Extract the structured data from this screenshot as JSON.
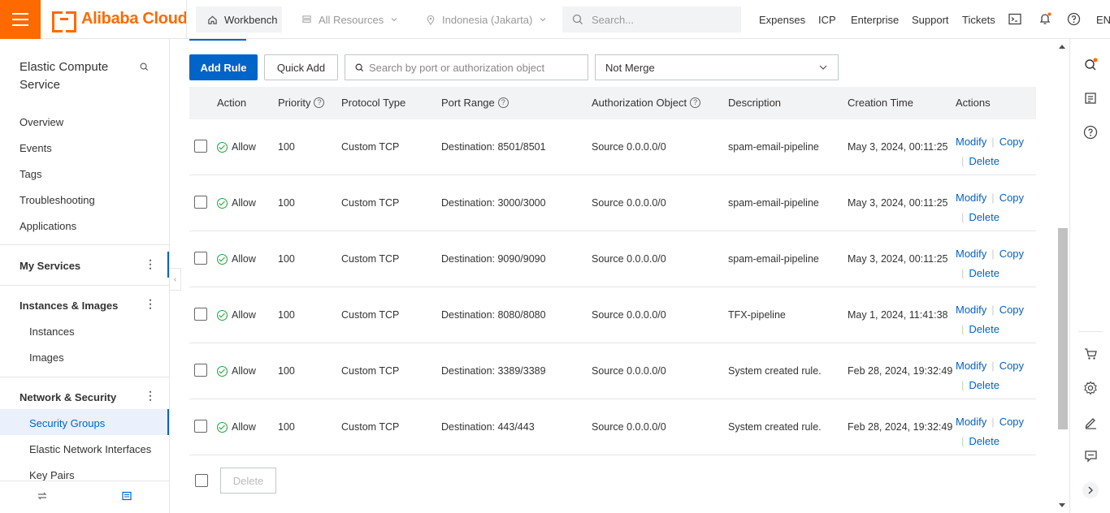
{
  "topbar": {
    "brand": "Alibaba Cloud",
    "workbench": "Workbench",
    "all_resources": "All Resources",
    "region": "Indonesia (Jakarta)",
    "search_placeholder": "Search...",
    "links": [
      "Expenses",
      "ICP",
      "Enterprise",
      "Support",
      "Tickets"
    ],
    "lang": "EN",
    "brand_color": "#ff6a00"
  },
  "sidebar": {
    "title": "Elastic Compute Service",
    "items": [
      "Overview",
      "Events",
      "Tags",
      "Troubleshooting",
      "Applications"
    ],
    "my_services": "My Services",
    "group1": {
      "label": "Instances & Images",
      "items": [
        "Instances",
        "Images"
      ]
    },
    "group2": {
      "label": "Network & Security",
      "items": [
        "Security Groups",
        "Elastic Network Interfaces",
        "Key Pairs"
      ]
    }
  },
  "toolbar": {
    "add_rule": "Add Rule",
    "quick_add": "Quick Add",
    "search_placeholder": "Search by port or authorization object",
    "merge_select": "Not Merge"
  },
  "table": {
    "headers": {
      "action": "Action",
      "priority": "Priority",
      "protocol": "Protocol Type",
      "port": "Port Range",
      "auth": "Authorization Object",
      "description": "Description",
      "created": "Creation Time",
      "actions": "Actions"
    },
    "rows": [
      {
        "action": "Allow",
        "priority": "100",
        "protocol": "Custom TCP",
        "port": "Destination: 8501/8501",
        "auth": "Source 0.0.0.0/0",
        "description": "spam-email-pipeline",
        "created": "May 3, 2024, 00:11:25"
      },
      {
        "action": "Allow",
        "priority": "100",
        "protocol": "Custom TCP",
        "port": "Destination: 3000/3000",
        "auth": "Source 0.0.0.0/0",
        "description": "spam-email-pipeline",
        "created": "May 3, 2024, 00:11:25"
      },
      {
        "action": "Allow",
        "priority": "100",
        "protocol": "Custom TCP",
        "port": "Destination: 9090/9090",
        "auth": "Source 0.0.0.0/0",
        "description": "spam-email-pipeline",
        "created": "May 3, 2024, 00:11:25"
      },
      {
        "action": "Allow",
        "priority": "100",
        "protocol": "Custom TCP",
        "port": "Destination: 8080/8080",
        "auth": "Source 0.0.0.0/0",
        "description": "TFX-pipeline",
        "created": "May 1, 2024, 11:41:38"
      },
      {
        "action": "Allow",
        "priority": "100",
        "protocol": "Custom TCP",
        "port": "Destination: 3389/3389",
        "auth": "Source 0.0.0.0/0",
        "description": "System created rule.",
        "created": "Feb 28, 2024, 19:32:49"
      },
      {
        "action": "Allow",
        "priority": "100",
        "protocol": "Custom TCP",
        "port": "Destination: 443/443",
        "auth": "Source 0.0.0.0/0",
        "description": "System created rule.",
        "created": "Feb 28, 2024, 19:32:49"
      }
    ],
    "row_actions": {
      "modify": "Modify",
      "copy": "Copy",
      "delete": "Delete"
    }
  },
  "footer": {
    "delete": "Delete"
  },
  "colors": {
    "primary": "#0064c8",
    "allow": "#1fa33b",
    "header_bg": "#f2f3f5"
  }
}
